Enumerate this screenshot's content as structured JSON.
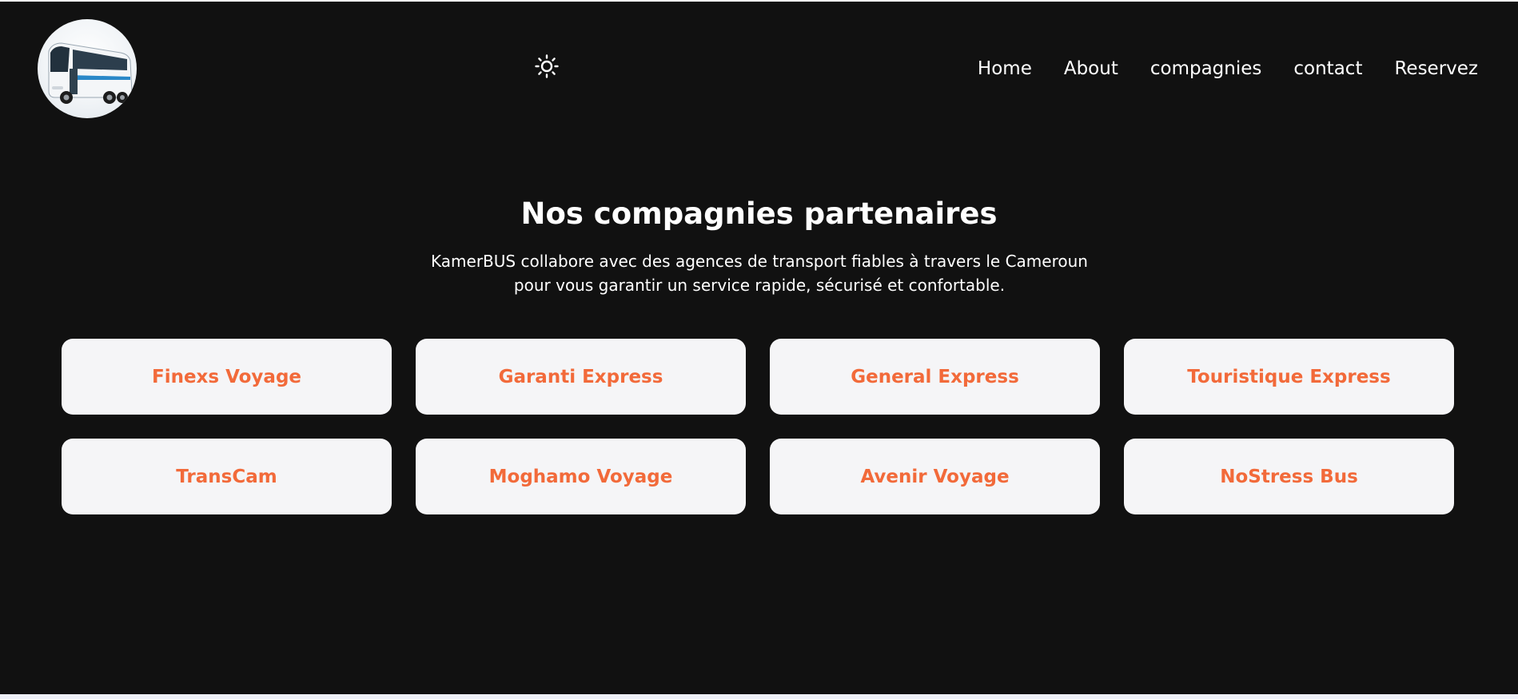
{
  "brand": {
    "logo_icon": "bus-logo"
  },
  "header": {
    "theme_toggle_icon": "sun-icon",
    "nav": [
      {
        "label": "Home"
      },
      {
        "label": "About"
      },
      {
        "label": "compagnies"
      },
      {
        "label": "contact"
      },
      {
        "label": "Reservez"
      }
    ]
  },
  "main": {
    "title": "Nos compagnies partenaires",
    "subtitle_line1": "KamerBUS collabore avec des agences de transport fiables à travers le Cameroun",
    "subtitle_line2": "pour vous garantir un service rapide, sécurisé et confortable.",
    "companies": [
      {
        "name": "Finexs Voyage"
      },
      {
        "name": "Garanti Express"
      },
      {
        "name": "General Express"
      },
      {
        "name": "Touristique Express"
      },
      {
        "name": "TransCam"
      },
      {
        "name": "Moghamo Voyage"
      },
      {
        "name": "Avenir Voyage"
      },
      {
        "name": "NoStress Bus"
      }
    ]
  },
  "colors": {
    "background": "#111111",
    "card_background": "#f5f5f7",
    "accent": "#f26a3a",
    "text": "#ffffff"
  }
}
